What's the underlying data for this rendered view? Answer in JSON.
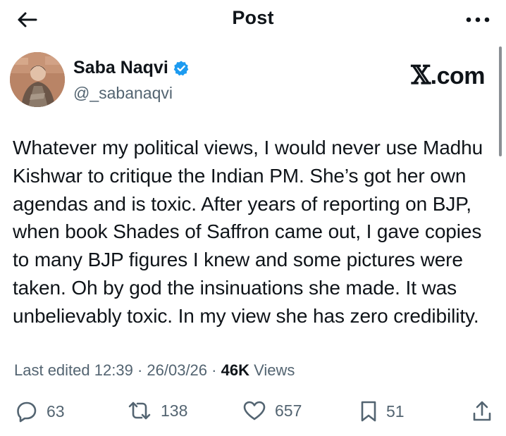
{
  "header": {
    "title": "Post",
    "back_icon": "arrow-left-icon",
    "more_icon": "more-horizontal-icon"
  },
  "author": {
    "name": "Saba Naqvi",
    "handle": "@_sabanaqvi",
    "verified": true,
    "verified_color": "#1d9bf0"
  },
  "watermark": {
    "brand_letter": "𝕏",
    "brand_suffix": ".com"
  },
  "tweet": {
    "lines": [
      "Whatever my political views, I would never use Madhu",
      "Kishwar to critique the Indian PM. She’s got her own",
      "agendas and is toxic. After years of reporting on BJP,",
      "when book Shades of Saffron came out, I gave copies",
      "to many BJP figures I knew and some pictures were",
      "taken. Oh by god the insinuations she made. It was",
      "unbelievably toxic. In my view she has zero credibility."
    ]
  },
  "meta": {
    "edited_label": "Last edited",
    "time": "12:39",
    "separator": " · ",
    "date": "26/03/26",
    "views_count": "46K",
    "views_label": "Views"
  },
  "actions": {
    "replies": "63",
    "reposts": "138",
    "likes": "657",
    "bookmarks": "51"
  },
  "colors": {
    "text_primary": "#0f1419",
    "text_secondary": "#536471",
    "accent": "#1d9bf0"
  }
}
